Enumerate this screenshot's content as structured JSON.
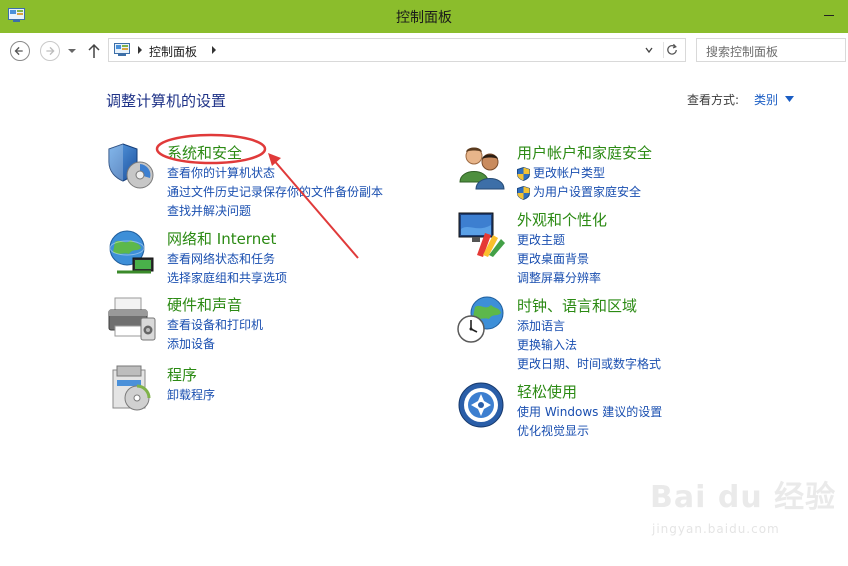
{
  "window": {
    "title": "控制面板"
  },
  "address_bar": {
    "path": "控制面板"
  },
  "search": {
    "placeholder": "搜索控制面板"
  },
  "main": {
    "heading": "调整计算机的设置",
    "view_by_label": "查看方式:",
    "view_by_value": "类别"
  },
  "categories": {
    "system": {
      "title": "系统和安全",
      "links": [
        "查看你的计算机状态",
        "通过文件历史记录保存你的文件备份副本",
        "查找并解决问题"
      ]
    },
    "network": {
      "title": "网络和 Internet",
      "links": [
        "查看网络状态和任务",
        "选择家庭组和共享选项"
      ]
    },
    "hardware": {
      "title": "硬件和声音",
      "links": [
        "查看设备和打印机",
        "添加设备"
      ]
    },
    "programs": {
      "title": "程序",
      "links": [
        "卸载程序"
      ]
    },
    "users": {
      "title": "用户帐户和家庭安全",
      "links": [
        "更改帐户类型",
        "为用户设置家庭安全"
      ]
    },
    "appearance": {
      "title": "外观和个性化",
      "links": [
        "更改主题",
        "更改桌面背景",
        "调整屏幕分辨率"
      ]
    },
    "clock": {
      "title": "时钟、语言和区域",
      "links": [
        "添加语言",
        "更换输入法",
        "更改日期、时间或数字格式"
      ]
    },
    "ease": {
      "title": "轻松使用",
      "links": [
        "使用 Windows 建议的设置",
        "优化视觉显示"
      ]
    }
  },
  "watermark": {
    "brand": "Bai du 经验",
    "url": "jingyan.baidu.com"
  },
  "colors": {
    "titlebar": "#8bbd2c",
    "category_title": "#2b8a13",
    "link": "#1a4fb0",
    "heading": "#1e3287",
    "annotation": "#e03a3a"
  }
}
